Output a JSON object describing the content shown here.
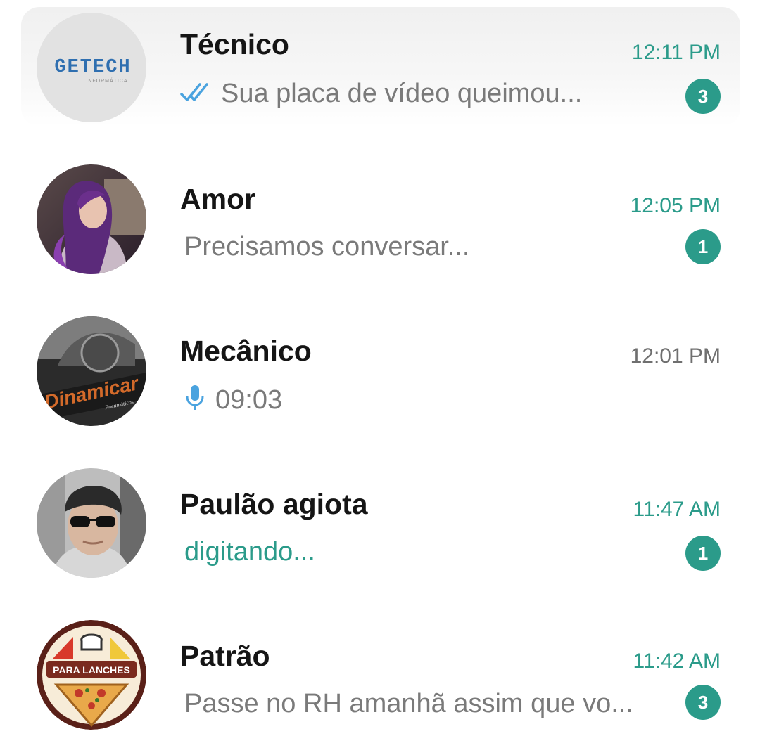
{
  "colors": {
    "accent": "#2b9b8a",
    "time_unread": "#2b9b8a",
    "time_read": "#6f6f6f",
    "preview_text": "#7a7a7a",
    "name_text": "#151515"
  },
  "chats": [
    {
      "name": "Técnico",
      "time": "12:11 PM",
      "preview": "Sua placa de vídeo queimou...",
      "preview_icon": "double-check-icon",
      "unread": "3",
      "avatar": {
        "logo_text": "GETECH",
        "logo_subtext": "INFORMÁTICA"
      }
    },
    {
      "name": "Amor",
      "time": "12:05 PM",
      "preview": "Precisamos conversar...",
      "unread": "1",
      "avatar": {
        "kind": "photo-woman"
      }
    },
    {
      "name": "Mecânico",
      "time": "12:01 PM",
      "preview": "09:03",
      "preview_icon": "microphone-icon",
      "avatar": {
        "logo_text": "Dinamicar",
        "logo_subtext": "Pneumáticos"
      }
    },
    {
      "name": "Paulão agiota",
      "time": "11:47 AM",
      "preview": "digitando...",
      "unread": "1",
      "avatar": {
        "kind": "photo-man-sunglasses"
      }
    },
    {
      "name": "Patrão",
      "time": "11:42 AM",
      "preview": "Passe no RH amanhã assim que vo...",
      "unread": "3",
      "avatar": {
        "logo_text": "PARA LANCHES"
      }
    }
  ]
}
